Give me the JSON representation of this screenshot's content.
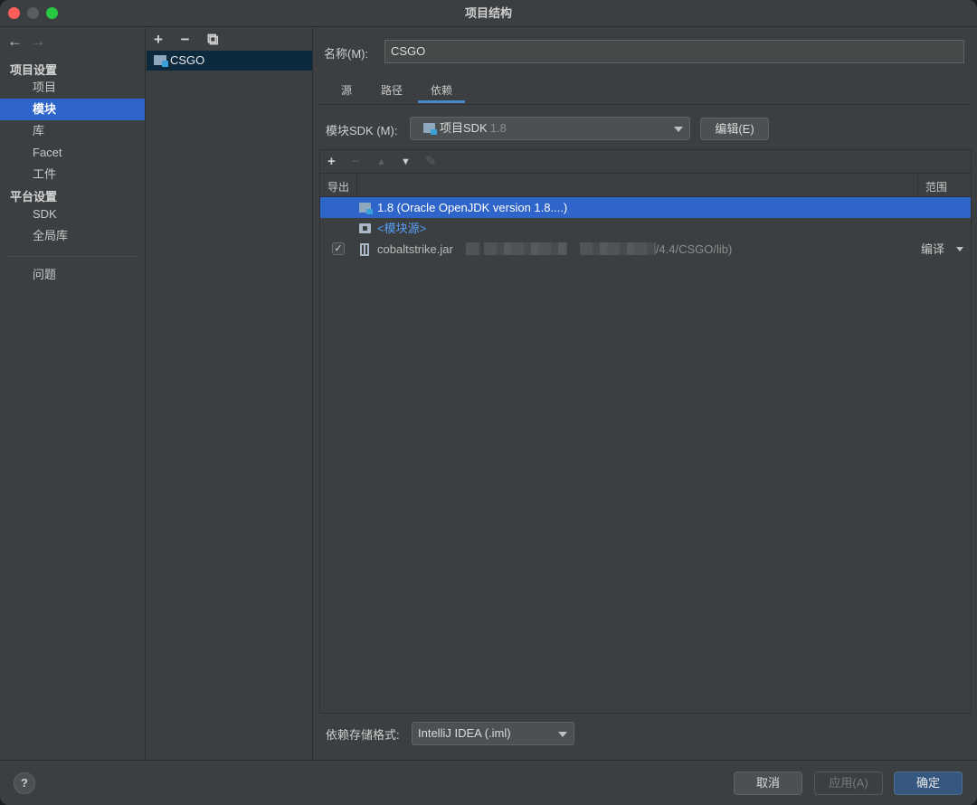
{
  "window": {
    "title": "项目结构"
  },
  "sidebar": {
    "nav": {
      "back": "←",
      "forward": "→"
    },
    "project_settings_header": "项目设置",
    "project_items": [
      {
        "label": "项目",
        "selected": false
      },
      {
        "label": "模块",
        "selected": true
      },
      {
        "label": "库",
        "selected": false
      },
      {
        "label": "Facet",
        "selected": false
      },
      {
        "label": "工件",
        "selected": false
      }
    ],
    "platform_settings_header": "平台设置",
    "platform_items": [
      {
        "label": "SDK"
      },
      {
        "label": "全局库"
      }
    ],
    "problems": "问题"
  },
  "modules": {
    "toolbar": {
      "add": "+",
      "remove": "−",
      "copy": "⧉"
    },
    "items": [
      {
        "label": "CSGO",
        "selected": true
      }
    ]
  },
  "detail": {
    "name_label": "名称(M):",
    "name_value": "CSGO",
    "tabs": [
      {
        "label": "源",
        "active": false
      },
      {
        "label": "路径",
        "active": false
      },
      {
        "label": "依赖",
        "active": true
      }
    ],
    "sdk": {
      "label": "模块SDK (M):",
      "value": "项目SDK",
      "version": "1.8",
      "edit_button": "编辑(E)"
    },
    "dependencies": {
      "toolbar": {
        "add": "+",
        "remove": "−",
        "up": "▲",
        "down": "▼",
        "edit": "✎"
      },
      "columns": {
        "export": "导出",
        "scope": "范围"
      },
      "rows": [
        {
          "text": "1.8 (Oracle OpenJDK version 1.8....)",
          "icon": "sdk-folder-icon",
          "selected": true
        },
        {
          "text": "<模块源>",
          "icon": "source-folder-icon"
        },
        {
          "text": "cobaltstrike.jar",
          "path_suffix": "/4.4/CSGO/lib)",
          "icon": "jar-icon",
          "checked": true,
          "scope": "编译"
        }
      ]
    },
    "storage_format": {
      "label": "依赖存储格式:",
      "value": "IntelliJ IDEA (.iml)"
    }
  },
  "footer": {
    "help": "?",
    "cancel": "取消",
    "apply": "应用(A)",
    "ok": "确定"
  },
  "colors": {
    "selection": "#2f65ca",
    "link": "#589df6",
    "primary_button": "#365880",
    "background": "#3c3f41"
  }
}
